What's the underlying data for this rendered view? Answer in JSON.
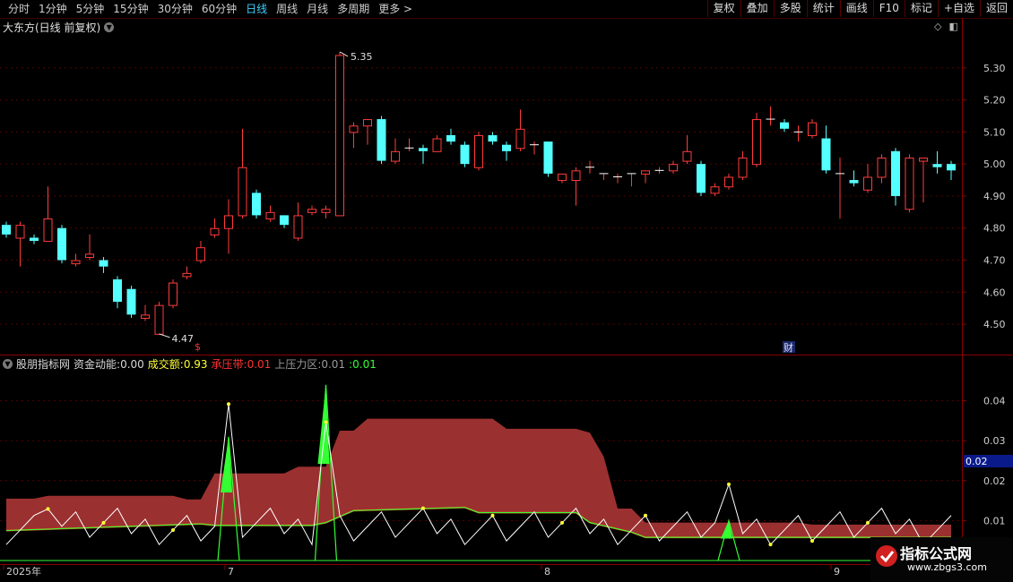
{
  "toolbar": {
    "periods": [
      "分时",
      "1分钟",
      "5分钟",
      "15分钟",
      "30分钟",
      "60分钟",
      "日线",
      "周线",
      "月线",
      "多周期",
      "更多 >"
    ],
    "selected_index": 6,
    "right_buttons": [
      "复权",
      "叠加",
      "多股",
      "统计",
      "画线",
      "F10",
      "标记",
      "+自选",
      "返回"
    ]
  },
  "main_panel": {
    "title": "大东方(日线 前复权)",
    "high_label": "5.35",
    "low_label": "4.47",
    "markers": [
      "$",
      "财"
    ],
    "y_ticks": [
      "5.30",
      "5.20",
      "5.10",
      "5.00",
      "4.90",
      "4.80",
      "4.70",
      "4.60",
      "4.50"
    ]
  },
  "indicator_panel": {
    "name": "股朋指标网",
    "fields": [
      {
        "label": "资金动能:",
        "value": "0.00",
        "color": "#d8d8d8"
      },
      {
        "label": "成交额:",
        "value": "0.93",
        "color": "#ffff33"
      },
      {
        "label": "承压带:",
        "value": "0.01",
        "color": "#ff3333"
      },
      {
        "label": "上压力区:",
        "value": "0.01",
        "color": "#9a9a9a"
      },
      {
        "label": ":",
        "value": "0.01",
        "color": "#33ff33"
      }
    ],
    "y_ticks": [
      "0.04",
      "0.03",
      "0.02",
      "0.01"
    ],
    "current_value": "0.02"
  },
  "x_axis": {
    "labels": [
      "2025年",
      "7",
      "8",
      "9"
    ]
  },
  "watermark": {
    "title": "指标公式网",
    "url": "www.zbgs3.com"
  },
  "colors": {
    "up": "#ff3b3b",
    "down": "#54ffff",
    "band": "#9b3030",
    "green": "#33ff33",
    "yellow": "#ffff33"
  },
  "chart_data": {
    "type": "candlestick",
    "y_range": [
      4.45,
      5.4
    ],
    "candles": [
      [
        4.81,
        4.78,
        4.82,
        4.77
      ],
      [
        4.77,
        4.81,
        4.82,
        4.68
      ],
      [
        4.77,
        4.76,
        4.78,
        4.75
      ],
      [
        4.76,
        4.83,
        4.93,
        4.76
      ],
      [
        4.8,
        4.7,
        4.81,
        4.69
      ],
      [
        4.69,
        4.7,
        4.72,
        4.68
      ],
      [
        4.71,
        4.72,
        4.78,
        4.7
      ],
      [
        4.7,
        4.68,
        4.71,
        4.66
      ],
      [
        4.64,
        4.57,
        4.65,
        4.55
      ],
      [
        4.61,
        4.53,
        4.62,
        4.52
      ],
      [
        4.52,
        4.53,
        4.56,
        4.51
      ],
      [
        4.47,
        4.56,
        4.57,
        4.47
      ],
      [
        4.56,
        4.63,
        4.64,
        4.55
      ],
      [
        4.65,
        4.66,
        4.68,
        4.64
      ],
      [
        4.7,
        4.74,
        4.76,
        4.69
      ],
      [
        4.78,
        4.8,
        4.83,
        4.77
      ],
      [
        4.8,
        4.84,
        4.89,
        4.72
      ],
      [
        4.84,
        4.99,
        5.11,
        4.83
      ],
      [
        4.91,
        4.84,
        4.92,
        4.83
      ],
      [
        4.83,
        4.85,
        4.87,
        4.82
      ],
      [
        4.84,
        4.81,
        4.84,
        4.8
      ],
      [
        4.77,
        4.84,
        4.88,
        4.76
      ],
      [
        4.85,
        4.86,
        4.87,
        4.84
      ],
      [
        4.85,
        4.86,
        4.87,
        4.83
      ],
      [
        4.84,
        5.34,
        5.35,
        4.84
      ],
      [
        5.1,
        5.12,
        5.13,
        5.05
      ],
      [
        5.12,
        5.14,
        5.14,
        5.06
      ],
      [
        5.14,
        5.01,
        5.15,
        5.0
      ],
      [
        5.01,
        5.04,
        5.08,
        5.0
      ],
      [
        5.05,
        5.05,
        5.08,
        5.04
      ],
      [
        5.05,
        5.04,
        5.06,
        5.0
      ],
      [
        5.04,
        5.08,
        5.09,
        5.04
      ],
      [
        5.09,
        5.07,
        5.11,
        5.06
      ],
      [
        5.06,
        5.0,
        5.07,
        4.99
      ],
      [
        4.99,
        5.09,
        5.1,
        4.98
      ],
      [
        5.09,
        5.07,
        5.1,
        5.06
      ],
      [
        5.06,
        5.04,
        5.07,
        5.01
      ],
      [
        5.05,
        5.11,
        5.17,
        5.04
      ],
      [
        5.06,
        5.06,
        5.07,
        5.03
      ],
      [
        5.07,
        4.97,
        5.07,
        4.96
      ],
      [
        4.95,
        4.97,
        4.97,
        4.94
      ],
      [
        4.95,
        4.98,
        4.99,
        4.87
      ],
      [
        4.99,
        4.99,
        5.01,
        4.97
      ],
      [
        4.97,
        4.97,
        4.97,
        4.95
      ],
      [
        4.96,
        4.96,
        4.97,
        4.94
      ],
      [
        4.97,
        4.97,
        4.97,
        4.93
      ],
      [
        4.97,
        4.98,
        4.98,
        4.94
      ],
      [
        4.98,
        4.98,
        4.99,
        4.97
      ],
      [
        4.98,
        5.0,
        5.01,
        4.97
      ],
      [
        5.01,
        5.04,
        5.09,
        5.0
      ],
      [
        5.0,
        4.91,
        5.01,
        4.9
      ],
      [
        4.91,
        4.93,
        4.94,
        4.9
      ],
      [
        4.93,
        4.96,
        4.97,
        4.92
      ],
      [
        4.96,
        5.02,
        5.04,
        4.95
      ],
      [
        5.0,
        5.14,
        5.16,
        4.99
      ],
      [
        5.14,
        5.14,
        5.18,
        5.12
      ],
      [
        5.13,
        5.11,
        5.14,
        5.1
      ],
      [
        5.1,
        5.1,
        5.12,
        5.07
      ],
      [
        5.09,
        5.13,
        5.14,
        5.08
      ],
      [
        5.08,
        4.98,
        5.12,
        4.97
      ],
      [
        4.97,
        4.97,
        5.02,
        4.83
      ],
      [
        4.95,
        4.94,
        4.98,
        4.93
      ],
      [
        4.92,
        4.96,
        5.0,
        4.91
      ],
      [
        4.96,
        5.02,
        5.03,
        4.94
      ],
      [
        5.04,
        4.9,
        5.05,
        4.87
      ],
      [
        4.86,
        5.02,
        5.03,
        4.85
      ],
      [
        5.01,
        5.02,
        5.02,
        4.88
      ],
      [
        5.0,
        4.99,
        5.04,
        4.97
      ],
      [
        5.0,
        4.98,
        5.01,
        4.95
      ]
    ]
  }
}
